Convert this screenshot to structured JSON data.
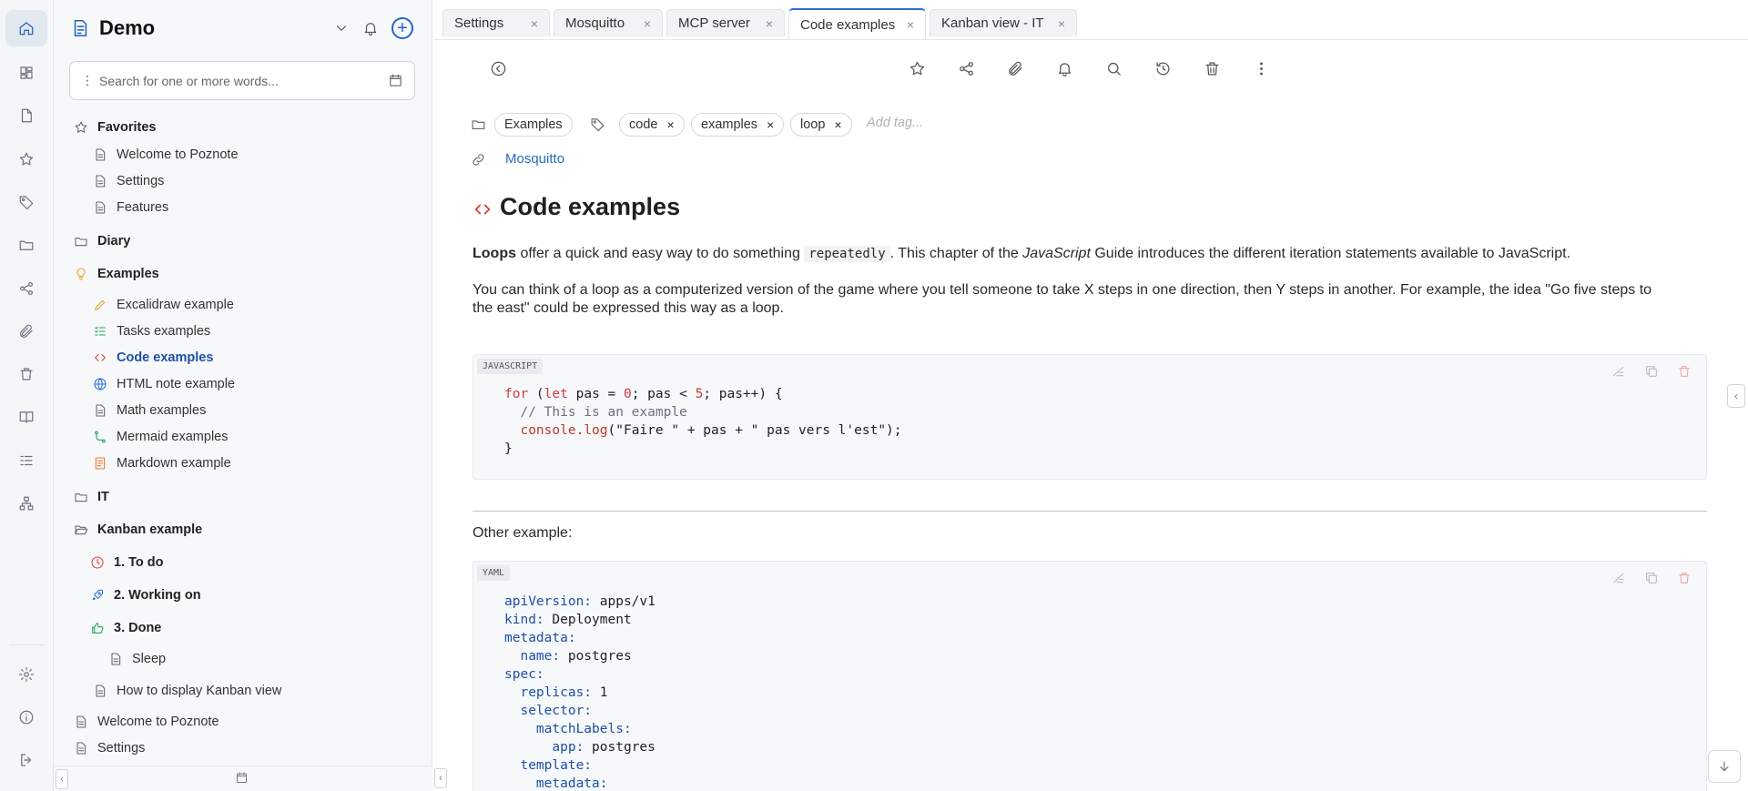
{
  "workspace": {
    "name": "Demo"
  },
  "search": {
    "placeholder": "Search for one or more words..."
  },
  "rail": {
    "items": [
      "home-icon",
      "dashboard-icon",
      "file-icon",
      "star-icon",
      "tag-icon",
      "folder-icon",
      "share-icon",
      "paperclip-icon",
      "trash-icon",
      "book-icon",
      "tasks-icon",
      "hierarchy-icon"
    ],
    "bottom": [
      "settings-icon",
      "info-icon",
      "logout-icon"
    ]
  },
  "tree": {
    "favorites": {
      "label": "Favorites",
      "items": [
        "Welcome to Poznote",
        "Settings",
        "Features"
      ]
    },
    "diary": {
      "label": "Diary"
    },
    "examples": {
      "label": "Examples",
      "items": [
        "Excalidraw example",
        "Tasks examples",
        "Code examples",
        "HTML note example",
        "Math examples",
        "Mermaid examples",
        "Markdown example"
      ]
    },
    "it": {
      "label": "IT"
    },
    "kanban": {
      "label": "Kanban example",
      "columns": [
        "1. To do",
        "2. Working on",
        "3. Done"
      ],
      "done_items": [
        "Sleep"
      ],
      "items": [
        "How to display Kanban view"
      ]
    },
    "root_items": [
      "Welcome to Poznote",
      "Settings"
    ]
  },
  "tabs": [
    {
      "label": "Settings",
      "active": false
    },
    {
      "label": "Mosquitto",
      "active": false
    },
    {
      "label": "MCP server",
      "active": false
    },
    {
      "label": "Code examples",
      "active": true
    },
    {
      "label": "Kanban view - IT",
      "active": false
    }
  ],
  "note": {
    "folder": "Examples",
    "tags": [
      "code",
      "examples",
      "loop"
    ],
    "add_tag_placeholder": "Add tag...",
    "linked_note": "Mosquitto",
    "title": "Code examples",
    "para1": {
      "bold": "Loops",
      "t1": " offer a quick and easy way to do something ",
      "code": "repeatedly",
      "t2": ". This chapter of the ",
      "italic": "JavaScript",
      "t3": " Guide introduces the different iteration statements available to JavaScript."
    },
    "para2": "You can think of a loop as a computerized version of the game where you tell someone to take X steps in one direction, then Y steps in another. For example, the idea \"Go five steps to the east\" could be expressed this way as a loop.",
    "code1": {
      "language": "JAVASCRIPT",
      "lines": {
        "l1a": "for",
        "l1b": " (",
        "l1c": "let",
        "l1d": " pas = ",
        "l1e": "0",
        "l1f": "; pas < ",
        "l1g": "5",
        "l1h": "; pas++) {",
        "l2": "  // This is an example",
        "l3a": "  console.",
        "l3b": "log",
        "l3c": "(\"Faire \" + pas + \" pas vers l'est\");",
        "l4": "}"
      }
    },
    "other_example": "Other example:",
    "code2": {
      "language": "YAML",
      "lines": [
        {
          "key": "apiVersion:",
          "val": " apps/v1"
        },
        {
          "key": "kind:",
          "val": " Deployment"
        },
        {
          "key": "metadata:",
          "val": ""
        },
        {
          "key": "  name:",
          "val": " postgres"
        },
        {
          "key": "spec:",
          "val": ""
        },
        {
          "key": "  replicas:",
          "val": " 1"
        },
        {
          "key": "  selector:",
          "val": ""
        },
        {
          "key": "    matchLabels:",
          "val": ""
        },
        {
          "key": "      app:",
          "val": " postgres"
        },
        {
          "key": "  template:",
          "val": ""
        },
        {
          "key": "    metadata:",
          "val": ""
        }
      ]
    }
  }
}
